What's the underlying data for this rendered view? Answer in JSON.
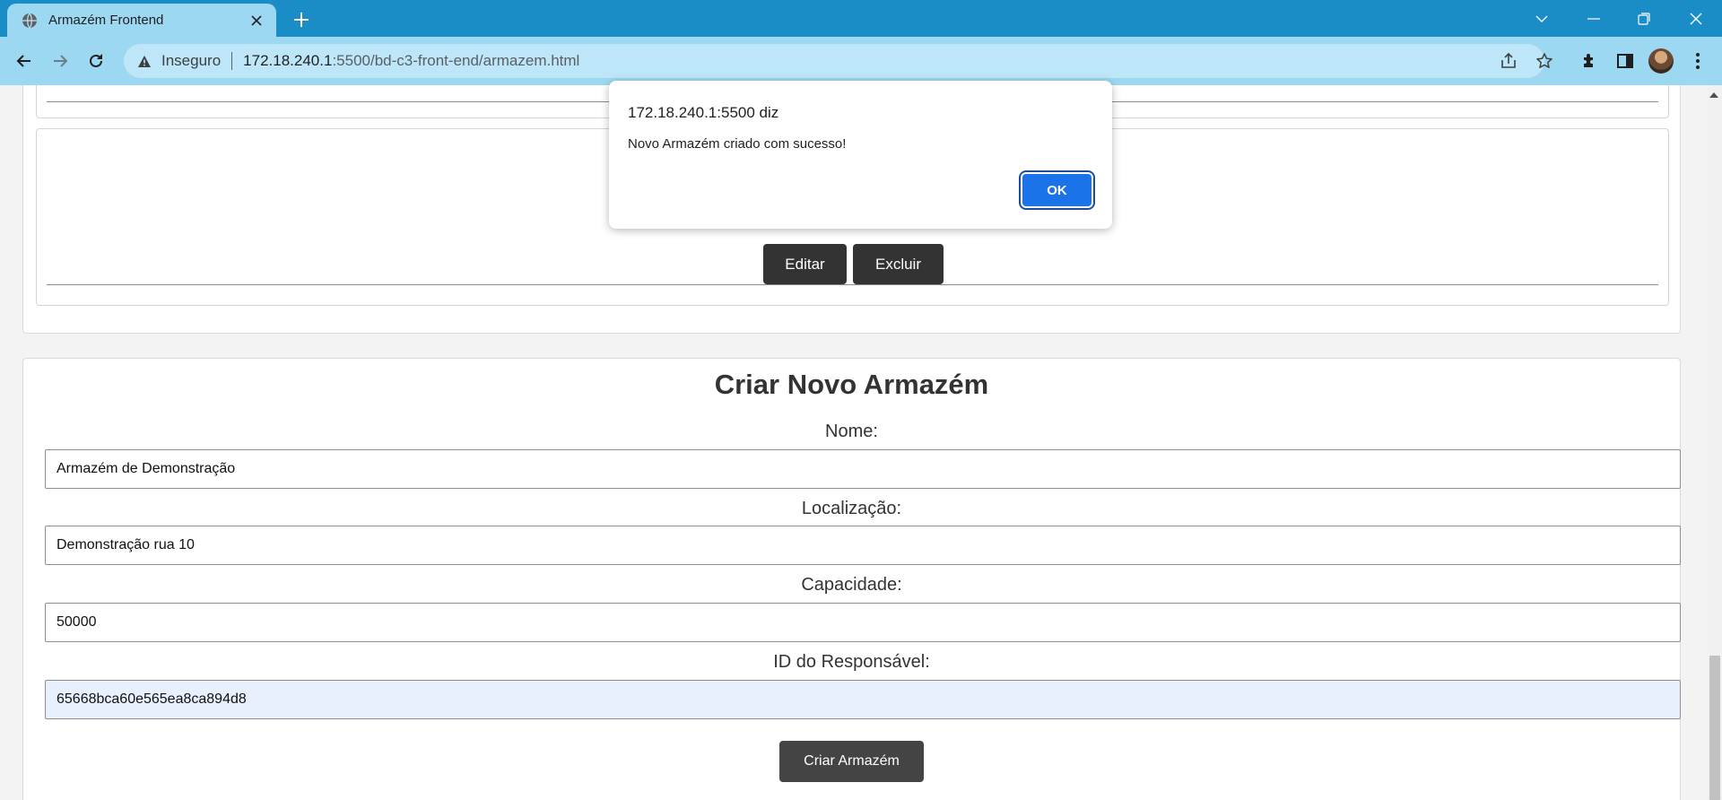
{
  "browser": {
    "tab_title": "Armazém Frontend",
    "omnibox": {
      "security_label": "Inseguro",
      "url_host": "172.18.240.1",
      "url_rest": ":5500/bd-c3-front-end/armazem.html"
    }
  },
  "list": {
    "edit_label": "Editar",
    "delete_label": "Excluir"
  },
  "form": {
    "title": "Criar Novo Armazém",
    "fields": [
      {
        "label": "Nome:",
        "value": "Armazém de Demonstração"
      },
      {
        "label": "Localização:",
        "value": "Demonstração rua 10"
      },
      {
        "label": "Capacidade:",
        "value": "50000"
      },
      {
        "label": "ID do Responsável:",
        "value": "65668bca60e565ea8ca894d8"
      }
    ],
    "submit_label": "Criar Armazém"
  },
  "dialog": {
    "title": "172.18.240.1:5500 diz",
    "message": "Novo Armazém criado com sucesso!",
    "ok_label": "OK"
  },
  "colors": {
    "tab_strip": "#1a8cc6",
    "toolbar": "#9dd8f2",
    "dialog_button": "#1a73e8",
    "dark_button": "#333333"
  }
}
